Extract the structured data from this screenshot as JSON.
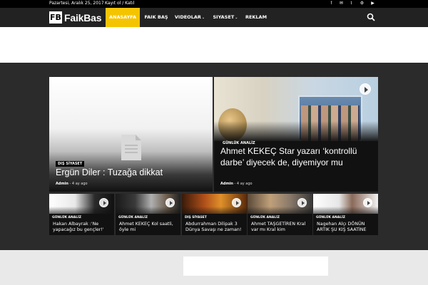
{
  "topbar": {
    "date": "Pazartesi, Aralık 25, 2017",
    "login": "Kayıt ol / Katıl",
    "social_icons": [
      "facebook-icon",
      "mail-icon",
      "twitter-icon",
      "vk-icon",
      "youtube-icon"
    ]
  },
  "nav": {
    "logo_mark": "FB",
    "logo_text": "FaikBas",
    "items": [
      {
        "label": "ANASAYFA",
        "active": true
      },
      {
        "label": "FAIK BAŞ",
        "active": false
      },
      {
        "label": "VIDEOLAR",
        "active": false,
        "dropdown": true
      },
      {
        "label": "SIYASET",
        "active": false,
        "dropdown": true
      },
      {
        "label": "REKLAM",
        "active": false
      }
    ],
    "search_icon": "search-icon",
    "chevron": "⌄"
  },
  "featured": {
    "big": [
      {
        "category": "DIŞ SİYASET",
        "title": "Ergün Diler : Tuzağa dikkat",
        "author": "Admin",
        "time": "4 ay ago"
      },
      {
        "category": "GÜNLÜK ANALİZ",
        "title": "Ahmet KEKEÇ Star yazarı ‘kontrollü darbe’ diyecek de, diyemiyor mu",
        "author": "Admin",
        "time": "4 ay ago"
      }
    ],
    "small": [
      {
        "category": "GÜNLÜK ANALİZ",
        "title": "Hakan Albayrak :'Ne yapacağız bu gençler!'"
      },
      {
        "category": "GÜNLÜK ANALİZ",
        "title": "Ahmet KEKEÇ Kol saatli, öyle mi"
      },
      {
        "category": "DIŞ SİYASET",
        "title": "Abdurrahman Dilipak 3 Dünya Savaşı ne zaman!"
      },
      {
        "category": "GÜNLÜK ANALİZ",
        "title": "Ahmet TAŞGETİREN Kral var mı Kral kim"
      },
      {
        "category": "GÜNLÜK ANALİZ",
        "title": "Nagehan Alçı DÖNÜN ARTIK ŞU KIŞ SAATİNE"
      }
    ]
  },
  "colors": {
    "accent": "#f5c400",
    "nav_bg": "#222222",
    "topbar_bg": "#000000",
    "feature_bg": "#2b2b2b"
  }
}
